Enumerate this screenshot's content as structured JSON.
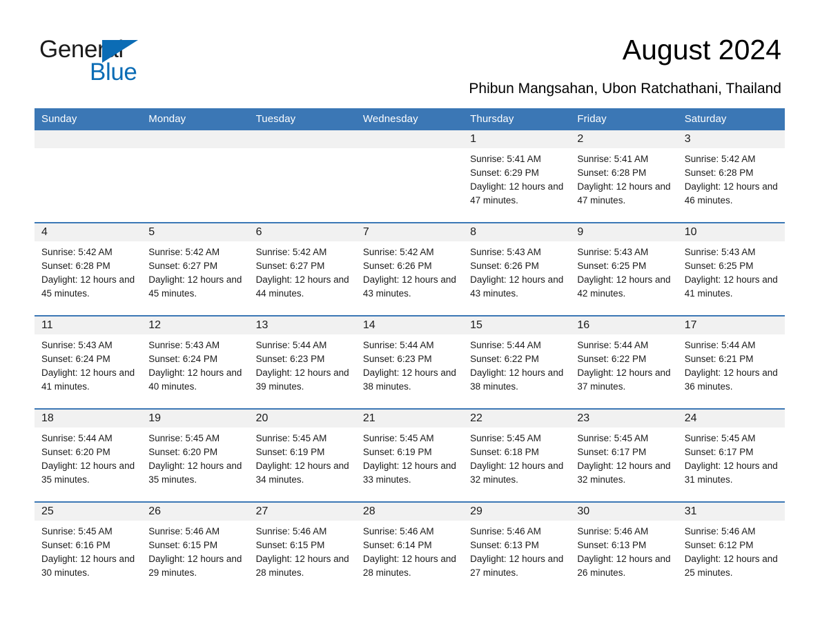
{
  "brand": {
    "name_part1": "General",
    "name_part2": "Blue",
    "triangle_color": "#0b6cb5"
  },
  "header": {
    "title": "August 2024",
    "subtitle": "Phibun Mangsahan, Ubon Ratchathani, Thailand"
  },
  "theme": {
    "header_blue": "#3b77b5",
    "daynum_gray": "#f1f1f1",
    "text": "#1a1a1a"
  },
  "calendar": {
    "weekdays": [
      "Sunday",
      "Monday",
      "Tuesday",
      "Wednesday",
      "Thursday",
      "Friday",
      "Saturday"
    ],
    "weeks": [
      [
        {
          "day": "",
          "empty": true
        },
        {
          "day": "",
          "empty": true
        },
        {
          "day": "",
          "empty": true
        },
        {
          "day": "",
          "empty": true
        },
        {
          "day": "1",
          "sunrise": "Sunrise: 5:41 AM",
          "sunset": "Sunset: 6:29 PM",
          "daylight": "Daylight: 12 hours and 47 minutes."
        },
        {
          "day": "2",
          "sunrise": "Sunrise: 5:41 AM",
          "sunset": "Sunset: 6:28 PM",
          "daylight": "Daylight: 12 hours and 47 minutes."
        },
        {
          "day": "3",
          "sunrise": "Sunrise: 5:42 AM",
          "sunset": "Sunset: 6:28 PM",
          "daylight": "Daylight: 12 hours and 46 minutes."
        }
      ],
      [
        {
          "day": "4",
          "sunrise": "Sunrise: 5:42 AM",
          "sunset": "Sunset: 6:28 PM",
          "daylight": "Daylight: 12 hours and 45 minutes."
        },
        {
          "day": "5",
          "sunrise": "Sunrise: 5:42 AM",
          "sunset": "Sunset: 6:27 PM",
          "daylight": "Daylight: 12 hours and 45 minutes."
        },
        {
          "day": "6",
          "sunrise": "Sunrise: 5:42 AM",
          "sunset": "Sunset: 6:27 PM",
          "daylight": "Daylight: 12 hours and 44 minutes."
        },
        {
          "day": "7",
          "sunrise": "Sunrise: 5:42 AM",
          "sunset": "Sunset: 6:26 PM",
          "daylight": "Daylight: 12 hours and 43 minutes."
        },
        {
          "day": "8",
          "sunrise": "Sunrise: 5:43 AM",
          "sunset": "Sunset: 6:26 PM",
          "daylight": "Daylight: 12 hours and 43 minutes."
        },
        {
          "day": "9",
          "sunrise": "Sunrise: 5:43 AM",
          "sunset": "Sunset: 6:25 PM",
          "daylight": "Daylight: 12 hours and 42 minutes."
        },
        {
          "day": "10",
          "sunrise": "Sunrise: 5:43 AM",
          "sunset": "Sunset: 6:25 PM",
          "daylight": "Daylight: 12 hours and 41 minutes."
        }
      ],
      [
        {
          "day": "11",
          "sunrise": "Sunrise: 5:43 AM",
          "sunset": "Sunset: 6:24 PM",
          "daylight": "Daylight: 12 hours and 41 minutes."
        },
        {
          "day": "12",
          "sunrise": "Sunrise: 5:43 AM",
          "sunset": "Sunset: 6:24 PM",
          "daylight": "Daylight: 12 hours and 40 minutes."
        },
        {
          "day": "13",
          "sunrise": "Sunrise: 5:44 AM",
          "sunset": "Sunset: 6:23 PM",
          "daylight": "Daylight: 12 hours and 39 minutes."
        },
        {
          "day": "14",
          "sunrise": "Sunrise: 5:44 AM",
          "sunset": "Sunset: 6:23 PM",
          "daylight": "Daylight: 12 hours and 38 minutes."
        },
        {
          "day": "15",
          "sunrise": "Sunrise: 5:44 AM",
          "sunset": "Sunset: 6:22 PM",
          "daylight": "Daylight: 12 hours and 38 minutes."
        },
        {
          "day": "16",
          "sunrise": "Sunrise: 5:44 AM",
          "sunset": "Sunset: 6:22 PM",
          "daylight": "Daylight: 12 hours and 37 minutes."
        },
        {
          "day": "17",
          "sunrise": "Sunrise: 5:44 AM",
          "sunset": "Sunset: 6:21 PM",
          "daylight": "Daylight: 12 hours and 36 minutes."
        }
      ],
      [
        {
          "day": "18",
          "sunrise": "Sunrise: 5:44 AM",
          "sunset": "Sunset: 6:20 PM",
          "daylight": "Daylight: 12 hours and 35 minutes."
        },
        {
          "day": "19",
          "sunrise": "Sunrise: 5:45 AM",
          "sunset": "Sunset: 6:20 PM",
          "daylight": "Daylight: 12 hours and 35 minutes."
        },
        {
          "day": "20",
          "sunrise": "Sunrise: 5:45 AM",
          "sunset": "Sunset: 6:19 PM",
          "daylight": "Daylight: 12 hours and 34 minutes."
        },
        {
          "day": "21",
          "sunrise": "Sunrise: 5:45 AM",
          "sunset": "Sunset: 6:19 PM",
          "daylight": "Daylight: 12 hours and 33 minutes."
        },
        {
          "day": "22",
          "sunrise": "Sunrise: 5:45 AM",
          "sunset": "Sunset: 6:18 PM",
          "daylight": "Daylight: 12 hours and 32 minutes."
        },
        {
          "day": "23",
          "sunrise": "Sunrise: 5:45 AM",
          "sunset": "Sunset: 6:17 PM",
          "daylight": "Daylight: 12 hours and 32 minutes."
        },
        {
          "day": "24",
          "sunrise": "Sunrise: 5:45 AM",
          "sunset": "Sunset: 6:17 PM",
          "daylight": "Daylight: 12 hours and 31 minutes."
        }
      ],
      [
        {
          "day": "25",
          "sunrise": "Sunrise: 5:45 AM",
          "sunset": "Sunset: 6:16 PM",
          "daylight": "Daylight: 12 hours and 30 minutes."
        },
        {
          "day": "26",
          "sunrise": "Sunrise: 5:46 AM",
          "sunset": "Sunset: 6:15 PM",
          "daylight": "Daylight: 12 hours and 29 minutes."
        },
        {
          "day": "27",
          "sunrise": "Sunrise: 5:46 AM",
          "sunset": "Sunset: 6:15 PM",
          "daylight": "Daylight: 12 hours and 28 minutes."
        },
        {
          "day": "28",
          "sunrise": "Sunrise: 5:46 AM",
          "sunset": "Sunset: 6:14 PM",
          "daylight": "Daylight: 12 hours and 28 minutes."
        },
        {
          "day": "29",
          "sunrise": "Sunrise: 5:46 AM",
          "sunset": "Sunset: 6:13 PM",
          "daylight": "Daylight: 12 hours and 27 minutes."
        },
        {
          "day": "30",
          "sunrise": "Sunrise: 5:46 AM",
          "sunset": "Sunset: 6:13 PM",
          "daylight": "Daylight: 12 hours and 26 minutes."
        },
        {
          "day": "31",
          "sunrise": "Sunrise: 5:46 AM",
          "sunset": "Sunset: 6:12 PM",
          "daylight": "Daylight: 12 hours and 25 minutes."
        }
      ]
    ]
  }
}
